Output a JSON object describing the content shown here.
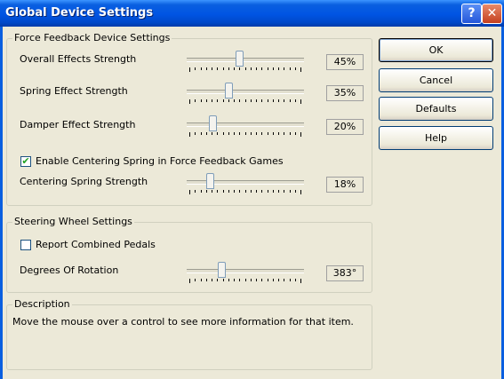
{
  "window": {
    "title": "Global Device Settings",
    "help_glyph": "?",
    "close_glyph": "✕"
  },
  "force_feedback": {
    "group_label": "Force Feedback Device Settings",
    "overall": {
      "label": "Overall Effects Strength",
      "value": 45,
      "display": "45%"
    },
    "spring": {
      "label": "Spring Effect Strength",
      "value": 35,
      "display": "35%"
    },
    "damper": {
      "label": "Damper Effect Strength",
      "value": 20,
      "display": "20%"
    },
    "centering_checkbox": {
      "label": "Enable Centering Spring in Force Feedback Games",
      "checked": true,
      "mark": "✔"
    },
    "centering": {
      "label": "Centering Spring Strength",
      "value": 18,
      "display": "18%"
    }
  },
  "steering": {
    "group_label": "Steering Wheel Settings",
    "pedals_checkbox": {
      "label": "Report Combined Pedals",
      "checked": false
    },
    "rotation": {
      "label": "Degrees Of Rotation",
      "value": 383,
      "min": 180,
      "max": 900,
      "display": "383°"
    }
  },
  "description": {
    "group_label": "Description",
    "text": "Move the mouse over a control to see more information for that item."
  },
  "buttons": {
    "ok": "OK",
    "cancel": "Cancel",
    "defaults": "Defaults",
    "help": "Help"
  }
}
